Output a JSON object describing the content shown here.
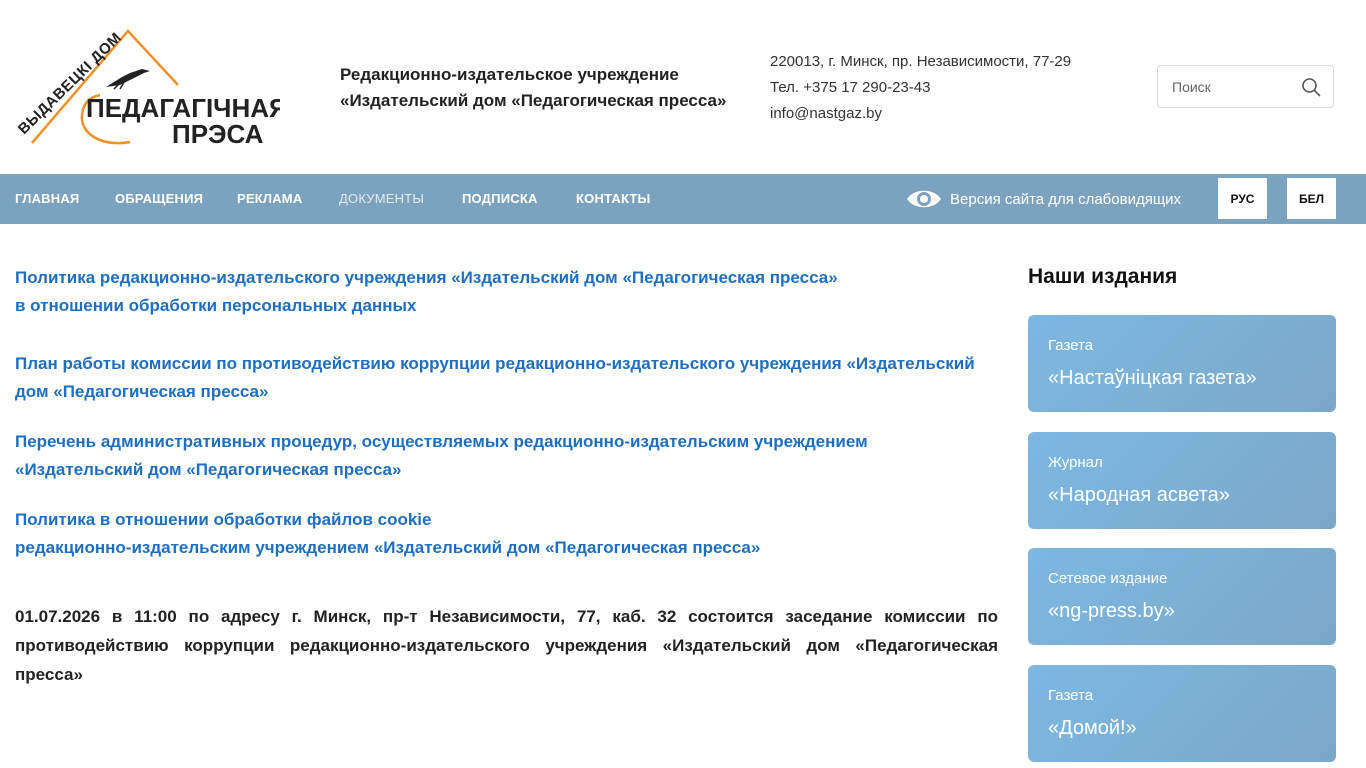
{
  "header": {
    "logo_text_arc": "ВЫДАВЕЦКІ ДОМ",
    "logo_text_line1": "ПЕДАГАГІЧНАЯ",
    "logo_text_line2": "ПРЭСА",
    "org_name_line1": "Редакционно-издательское учреждение",
    "org_name_line2": "«Издательский дом «Педагогическая пресса»",
    "address": "220013, г. Минск, пр. Независимости, 77-29",
    "phone": "Тел. +375 17 290-23-43",
    "email": "info@nastgaz.by",
    "search_placeholder": "Поиск"
  },
  "nav": {
    "items": [
      {
        "label": "ГЛАВНАЯ"
      },
      {
        "label": "ОБРАЩЕНИЯ"
      },
      {
        "label": "РЕКЛАМА"
      },
      {
        "label": "ДОКУМЕНТЫ"
      },
      {
        "label": "ПОДПИСКА"
      },
      {
        "label": "КОНТАКТЫ"
      }
    ],
    "vision_label": "Версия сайта для слабовидящих",
    "lang_ru": "РУС",
    "lang_be": "БЕЛ"
  },
  "documents": [
    {
      "line1": "Политика редакционно-издательского учреждения «Издательский дом «Педагогическая пресса»",
      "line2": "в отношении обработки персональных данных"
    },
    {
      "line1": "План работы комиссии по противодействию коррупции редакционно-издательского учреждения «Издательский",
      "line2": "дом «Педагогическая пресса»"
    },
    {
      "line1": "Перечень административных процедур, осуществляемых редакционно-издательским учреждением",
      "line2": "«Издательский дом «Педагогическая пресса»"
    },
    {
      "line1": "Политика в отношении обработки файлов cookie",
      "line2": "редакционно-издательским учреждением «Издательский дом «Педагогическая пресса»"
    }
  ],
  "notice": "01.07.2026 в 11:00 по адресу г. Минск, пр-т Независимости, 77, каб. 32 состоится заседание комиссии по противодействию коррупции редакционно-издательского учреждения «Издательский дом «Педагогическая пресса»",
  "sidebar": {
    "title": "Наши издания",
    "cards": [
      {
        "type": "Газета",
        "name": "«Настаўніцкая газета»"
      },
      {
        "type": "Журнал",
        "name": "«Народная асвета»"
      },
      {
        "type": "Сетевое издание",
        "name": "«ng-press.by»"
      },
      {
        "type": "Газета",
        "name": "«Домой!»"
      }
    ]
  },
  "colors": {
    "nav_bg": "#7ba3bf",
    "link": "#1f6fc0",
    "logo_orange": "#f0922b",
    "card_gradient_start": "#7cb8e3",
    "card_gradient_end": "#7ba8c7"
  }
}
